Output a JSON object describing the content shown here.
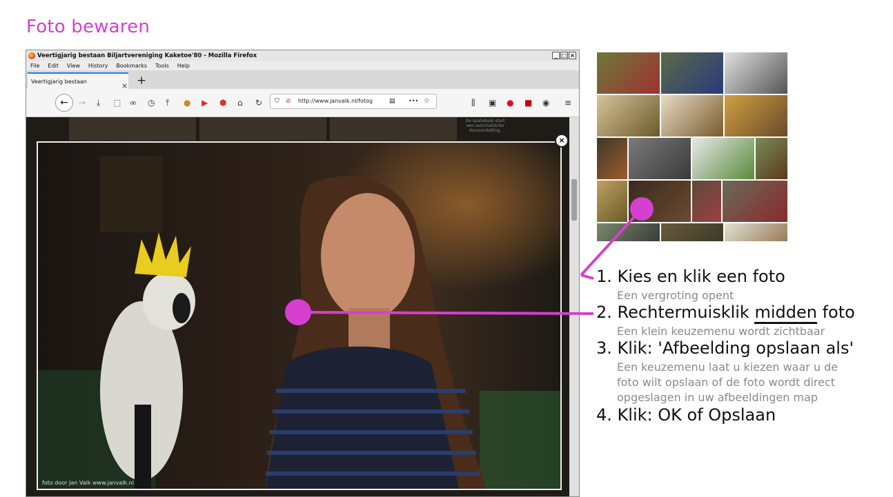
{
  "page_title": "Foto bewaren",
  "browser": {
    "window_title": "Veertigjarig bestaan Biljartvereniging Kaketoe'80 - Mozilla Firefox",
    "window_buttons": [
      "_",
      "□",
      "×"
    ],
    "menu": [
      "File",
      "Edit",
      "View",
      "History",
      "Bookmarks",
      "Tools",
      "Help"
    ],
    "tab_label": "Veertigjarig bestaan Biljartvereniging",
    "tab_close": "×",
    "new_tab": "+",
    "url": "http://www.janvalk.nl/fotog",
    "url_more": "•••",
    "sidenote": "De spatiebalk start een automatische diavoorstelling.",
    "close_label": "×",
    "photo_credit": "foto door Jan Valk     www.janvalk.nl",
    "icons": [
      "back-arrow-icon",
      "forward-arrow-icon",
      "download-icon",
      "screenshot-icon",
      "glasses-icon",
      "history-icon",
      "upload-icon",
      "cookie-icon",
      "youtube-icon",
      "adblock-icon",
      "home-icon",
      "reload-icon",
      "shield-icon",
      "tracking-icon",
      "reader-icon",
      "more-icon",
      "bookmark-star-icon",
      "library-icon",
      "sidebar-icon",
      "pocket-icon",
      "pdf-icon",
      "account-icon",
      "menu-icon"
    ]
  },
  "steps": [
    {
      "num": "1.",
      "text": "Kies en klik een foto",
      "sub": [
        "Een vergroting opent"
      ]
    },
    {
      "num": "2.",
      "text_before": "Rechtermuisklik ",
      "text_under": "midden",
      "text_after": " foto",
      "sub": [
        "Een klein keuzemenu wordt zichtbaar"
      ]
    },
    {
      "num": "3.",
      "text": "Klik: 'Afbeelding opslaan als'",
      "sub": [
        "Een keuzemenu laat u kiezen waar u de",
        "foto wilt opslaan of de foto wordt direct",
        "opgeslagen in uw afbeeldingen map"
      ]
    },
    {
      "num": "4.",
      "text": "Klik: OK of Opslaan",
      "sub": []
    }
  ],
  "colors": {
    "accent": "#d63fd0",
    "step_text": "#111111",
    "sub_text": "#8a8a8a"
  }
}
